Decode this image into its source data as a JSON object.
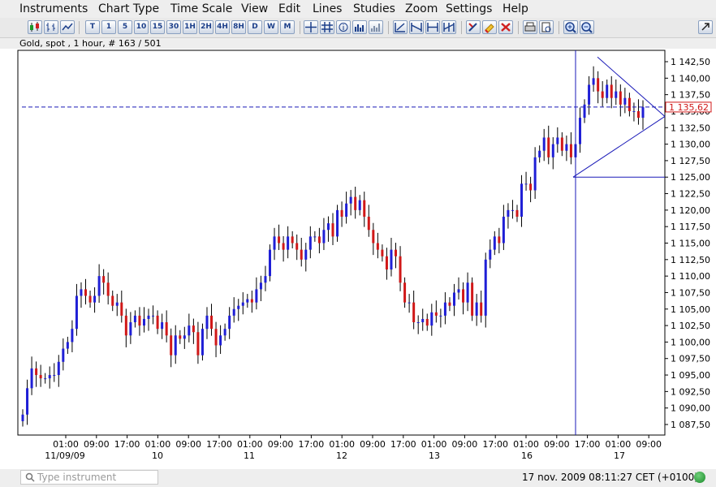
{
  "menu": [
    "Instruments",
    "Chart Type",
    "Time Scale",
    "View",
    "Edit",
    "Lines",
    "Studies",
    "Zoom",
    "Settings",
    "Help"
  ],
  "toolbar": {
    "periods": [
      "T",
      "1",
      "5",
      "10",
      "15",
      "30",
      "1H",
      "2H",
      "4H",
      "8H",
      "D",
      "W",
      "M"
    ]
  },
  "chart": {
    "info": "Gold, spot , 1 hour, # 163 / 501",
    "price_labels": [
      "1 142,50",
      "1 140,00",
      "1 137,50",
      "1 135,00",
      "1 132,50",
      "1 130,00",
      "1 127,50",
      "1 125,00",
      "1 122,50",
      "1 120,00",
      "1 117,50",
      "1 115,00",
      "1 112,50",
      "1 110,00",
      "1 107,50",
      "1 105,00",
      "1 102,50",
      "1 100,00",
      "1 097,50",
      "1 095,00",
      "1 092,50",
      "1 090,00",
      "1 087,50"
    ],
    "current_price": "1 135,62",
    "time_labels": [
      "01:00",
      "09:00",
      "17:00",
      "01:00",
      "09:00",
      "17:00",
      "01:00",
      "09:00",
      "17:00",
      "01:00",
      "09:00",
      "17:00",
      "01:00",
      "09:00",
      "17:00",
      "01:00",
      "09:00",
      "17:00",
      "01:00",
      "09:00"
    ],
    "date_labels": [
      "11/09/09",
      "10",
      "11",
      "12",
      "13",
      "16",
      "17"
    ],
    "colors": {
      "up": "#1f1fd6",
      "down": "#d01818",
      "line": "#1a1ab8",
      "grid": "#000000"
    }
  },
  "chart_data": {
    "type": "candlestick",
    "title": "Gold, spot , 1 hour, # 163 / 501",
    "y_range": [
      1086,
      1145
    ],
    "current_price": 1135.62,
    "closes": [
      1089,
      1093,
      1096,
      1095,
      1094.5,
      1094.5,
      1095,
      1095,
      1097,
      1099,
      1100,
      1102,
      1107,
      1108,
      1107,
      1106,
      1107,
      1110,
      1109,
      1107,
      1105.5,
      1106,
      1104,
      1101,
      1103,
      1104,
      1102.5,
      1103.5,
      1104,
      1104,
      1102,
      1103,
      1101,
      1098,
      1101,
      1100.5,
      1101,
      1102.5,
      1101.5,
      1098,
      1102,
      1104,
      1102,
      1099.5,
      1101,
      1102,
      1104,
      1105,
      1105.5,
      1106,
      1106.5,
      1106,
      1108,
      1109,
      1110,
      1114,
      1116,
      1115,
      1114,
      1116,
      1115,
      1114,
      1112.5,
      1114,
      1116,
      1116,
      1115,
      1117,
      1118,
      1116,
      1120,
      1119,
      1121,
      1122,
      1120,
      1121.5,
      1119,
      1117,
      1115,
      1114,
      1113,
      1111,
      1114,
      1113,
      1109,
      1106,
      1106,
      1103,
      1103,
      1103.5,
      1102.5,
      1104.5,
      1104,
      1104,
      1106,
      1105.5,
      1107.5,
      1108,
      1106,
      1109,
      1104,
      1106,
      1104,
      1112.5,
      1114,
      1116,
      1115,
      1119,
      1120,
      1120,
      1119,
      1124,
      1124,
      1123,
      1128,
      1129,
      1131,
      1128,
      1130,
      1131,
      1129,
      1130,
      1128,
      1130,
      1134,
      1136,
      1139,
      1140,
      1138,
      1137,
      1139,
      1137,
      1138,
      1136,
      1137,
      1135,
      1135,
      1134,
      1135.6
    ]
  }
}
